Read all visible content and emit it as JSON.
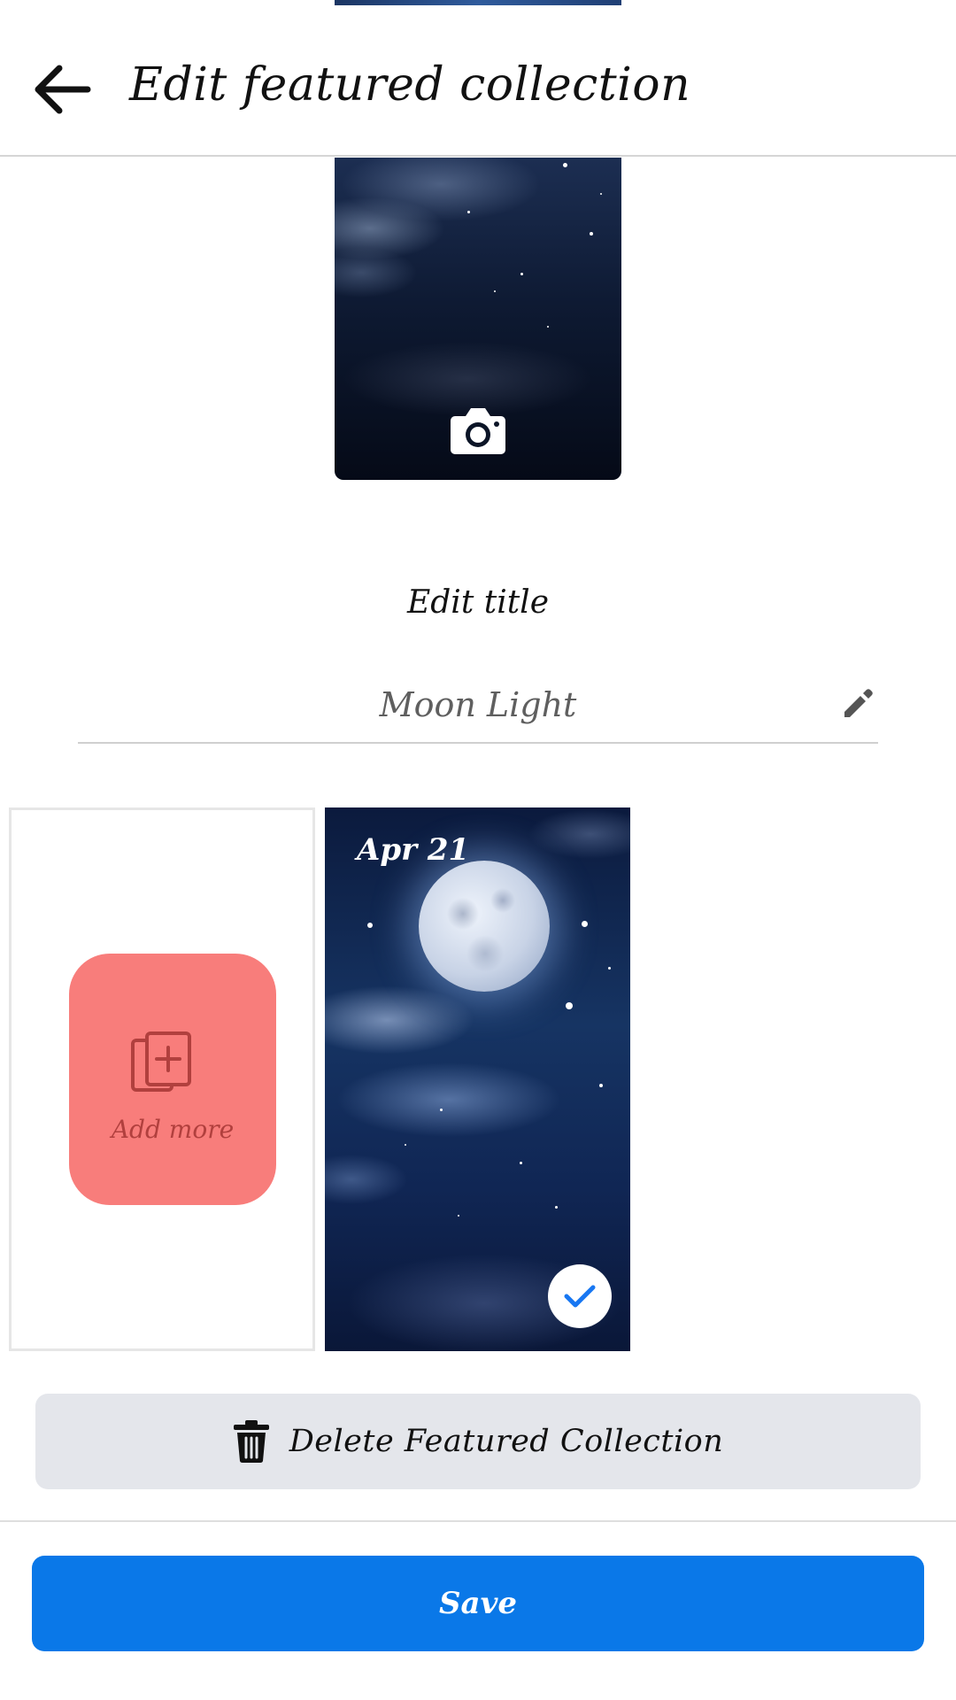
{
  "header": {
    "title": "Edit featured collection",
    "back_icon": "arrow-left-icon"
  },
  "cover": {
    "camera_icon": "camera-icon"
  },
  "title_editor": {
    "label": "Edit title",
    "value": "Moon Light",
    "edit_icon": "pencil-icon"
  },
  "stories": {
    "add_more": {
      "label": "Add more",
      "icon": "add-photo-icon",
      "color": "#f87d7b"
    },
    "items": [
      {
        "date": "Apr 21",
        "selected": true,
        "check_icon": "checkmark-icon"
      }
    ]
  },
  "actions": {
    "delete_label": "Delete Featured Collection",
    "delete_icon": "trash-icon",
    "save_label": "Save",
    "save_color": "#0a78e8"
  }
}
